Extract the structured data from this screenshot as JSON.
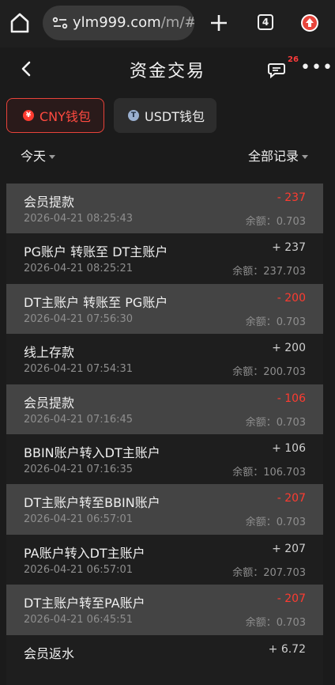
{
  "browser": {
    "url_domain": "ylm999.com",
    "url_path": "/m/#/",
    "tab_count": "4",
    "icons": [
      "home-icon",
      "site-settings-icon",
      "new-tab-icon",
      "tabs-icon",
      "update-icon"
    ]
  },
  "header": {
    "title": "资金交易",
    "chat_badge": "26",
    "icons": [
      "back-icon",
      "chat-icon",
      "more-icon"
    ]
  },
  "wallets": [
    {
      "label": "CNY钱包",
      "coin_glyph": "¥",
      "active": true
    },
    {
      "label": "USDT钱包",
      "coin_glyph": "T",
      "active": false
    }
  ],
  "filters": {
    "period": "今天",
    "type": "全部记录"
  },
  "records": [
    {
      "title": "会员提款",
      "time": "2026-04-21 08:25:43",
      "amount": "- 237",
      "balance": "余额：0.703"
    },
    {
      "title": "PG账户 转账至 DT主账户",
      "time": "2026-04-21 08:25:21",
      "amount": "+ 237",
      "balance": "余额：237.703"
    },
    {
      "title": "DT主账户 转账至 PG账户",
      "time": "2026-04-21 07:56:30",
      "amount": "- 200",
      "balance": "余额：0.703"
    },
    {
      "title": "线上存款",
      "time": "2026-04-21 07:54:31",
      "amount": "+ 200",
      "balance": "余额：200.703"
    },
    {
      "title": "会员提款",
      "time": "2026-04-21 07:16:45",
      "amount": "- 106",
      "balance": "余额：0.703"
    },
    {
      "title": "BBIN账户转入DT主账户",
      "time": "2026-04-21 07:16:35",
      "amount": "+ 106",
      "balance": "余额：106.703"
    },
    {
      "title": "DT主账户转至BBIN账户",
      "time": "2026-04-21 06:57:01",
      "amount": "- 207",
      "balance": "余额：0.703"
    },
    {
      "title": "PA账户转入DT主账户",
      "time": "2026-04-21 06:57:01",
      "amount": "+ 207",
      "balance": "余额：207.703"
    },
    {
      "title": "DT主账户转至PA账户",
      "time": "2026-04-21 06:45:51",
      "amount": "- 207",
      "balance": "余额：0.703"
    },
    {
      "title": "会员返水",
      "time": "",
      "amount": "+ 6.72",
      "balance": ""
    }
  ],
  "colors": {
    "accent": "#ff3b30",
    "background": "#1b1b1b",
    "row_highlight": "#444444"
  }
}
